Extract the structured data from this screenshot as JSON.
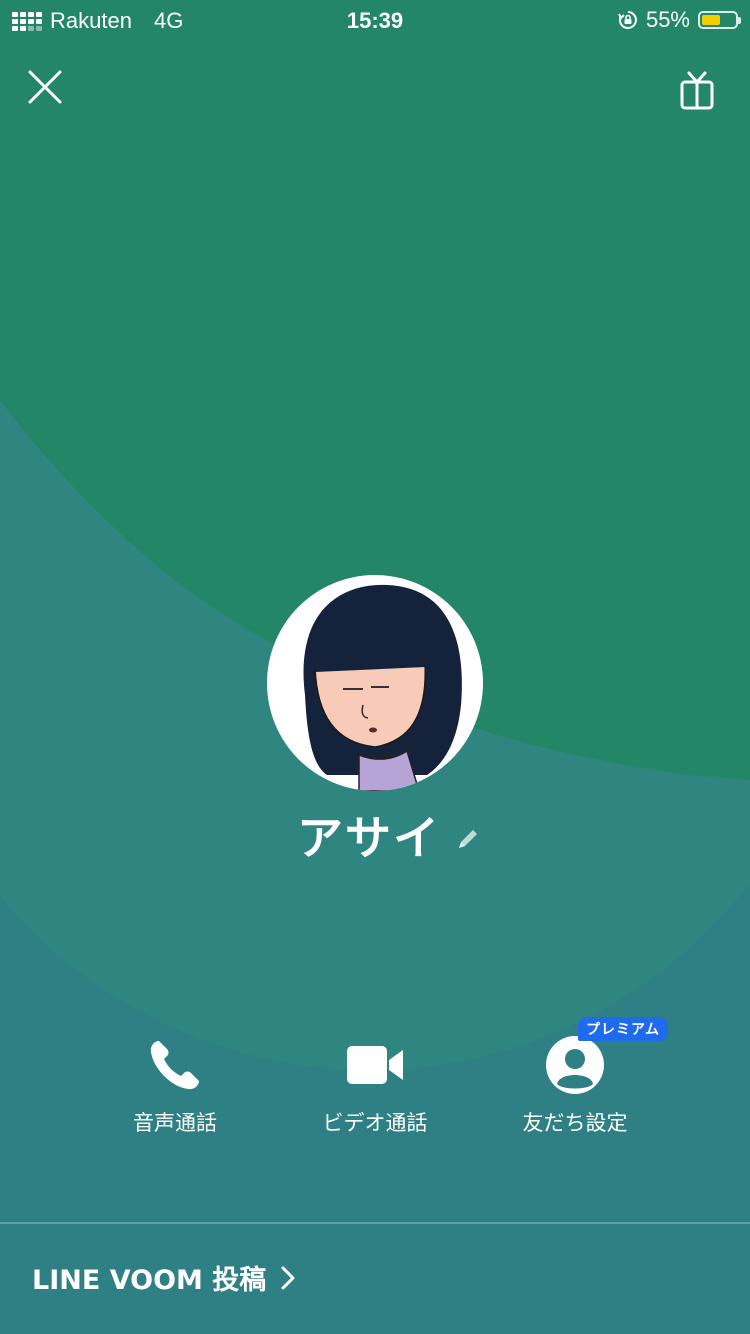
{
  "status_bar": {
    "carrier": "Rakuten",
    "network": "4G",
    "time": "15:39",
    "battery_percent_label": "55%",
    "battery_level": 0.55,
    "battery_color": "#f4cf00"
  },
  "header": {
    "close_icon": "close-icon",
    "gift_icon": "gift-icon"
  },
  "profile": {
    "name": "アサイ",
    "edit_icon": "pencil-icon"
  },
  "actions": [
    {
      "label": "音声通話",
      "icon": "phone-icon"
    },
    {
      "label": "ビデオ通話",
      "icon": "video-camera-icon"
    },
    {
      "label": "友だち設定",
      "icon": "person-icon",
      "badge": "プレミアム"
    }
  ],
  "footer": {
    "voom_label": "LINE VOOM 投稿",
    "chevron_icon": "chevron-right-icon"
  },
  "colors": {
    "background_top": "#228667",
    "background_bottom": "#2e8084",
    "badge": "#1e6bf0"
  }
}
